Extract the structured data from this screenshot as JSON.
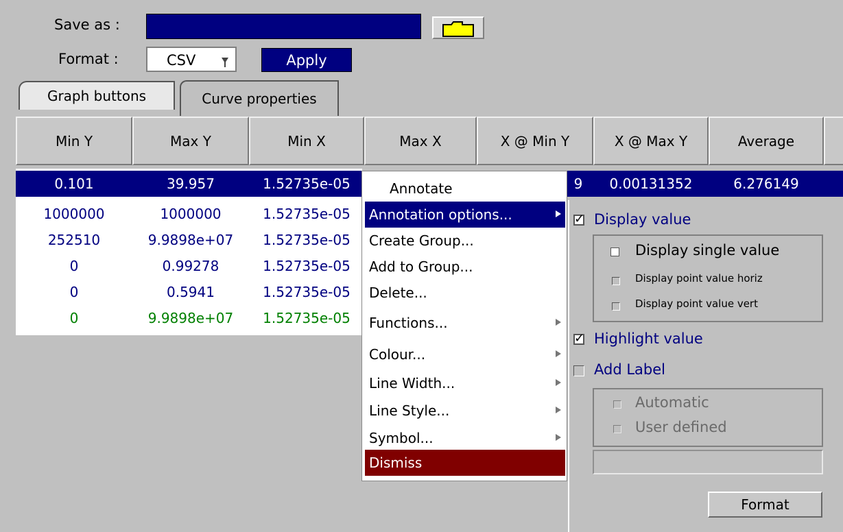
{
  "top": {
    "save_as_label": "Save as :",
    "format_label": "Format :",
    "format_value": "CSV",
    "apply_label": "Apply"
  },
  "tabs": [
    {
      "label": "Graph buttons"
    },
    {
      "label": "Curve properties"
    }
  ],
  "table": {
    "headers": [
      "Min Y",
      "Max Y",
      "Min X",
      "Max X",
      "X @ Min Y",
      "X @ Max Y",
      "Average"
    ],
    "rows": [
      {
        "min_y": "0.101",
        "max_y": "39.957",
        "min_x": "1.52735e-05",
        "x_min_y_tail": "9",
        "x_max_y": "0.00131352",
        "average": "6.276149"
      },
      {
        "min_y": "1000000",
        "max_y": "1000000",
        "min_x": "1.52735e-05"
      },
      {
        "min_y": "252510",
        "max_y": "9.9898e+07",
        "min_x": "1.52735e-05"
      },
      {
        "min_y": "0",
        "max_y": "0.99278",
        "min_x": "1.52735e-05"
      },
      {
        "min_y": "0",
        "max_y": "0.5941",
        "min_x": "1.52735e-05"
      },
      {
        "min_y": "0",
        "max_y": "9.9898e+07",
        "min_x": "1.52735e-05"
      }
    ]
  },
  "context_menu": {
    "items": [
      "Annotate",
      "Annotation options...",
      "Create Group...",
      "Add to Group...",
      "Delete...",
      "Functions...",
      "Colour...",
      "Line Width...",
      "Line Style...",
      "Symbol...",
      "Dismiss"
    ]
  },
  "annotation_panel": {
    "display_value": "Display value",
    "display_single_value": "Display single value",
    "display_point_value_horiz": "Display point value horiz",
    "display_point_value_vert": "Display point value vert",
    "highlight_value": "Highlight value",
    "add_label": "Add Label",
    "automatic": "Automatic",
    "user_defined": "User defined",
    "format_button": "Format"
  },
  "colors": {
    "background": "#c0c0c0",
    "selection": "#000080",
    "dismiss": "#800000",
    "row_blue": "#000080",
    "row_green": "#008000",
    "folder_yellow": "#ffff00"
  }
}
